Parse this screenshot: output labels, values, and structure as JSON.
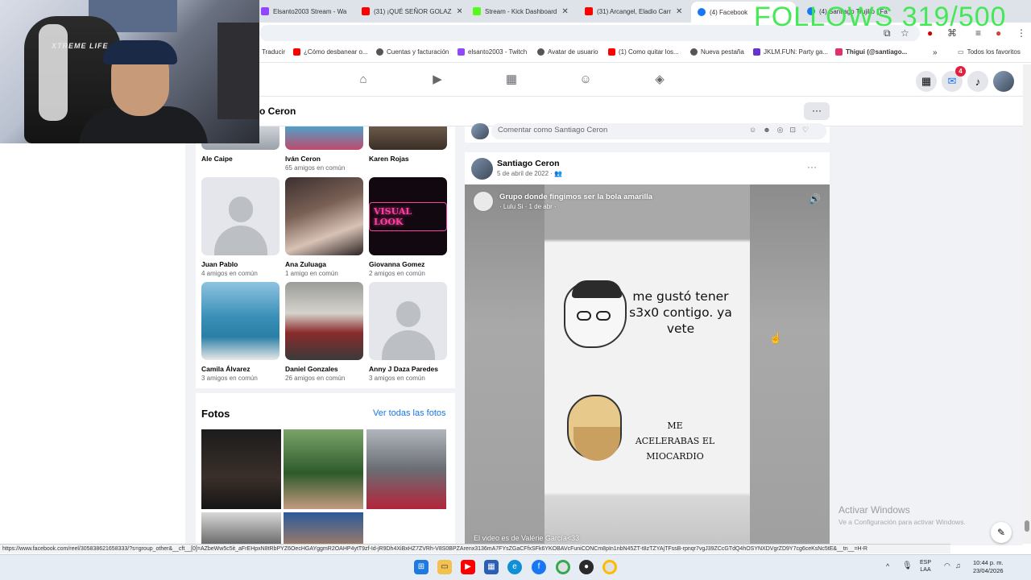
{
  "overlay": {
    "follows_text": "FOLLOWS 319/500"
  },
  "webcam": {
    "chair_logo": "XTREME LIFE"
  },
  "tabs": [
    {
      "label": "Elsanto2003 Stream - Wa",
      "favicon_color": "#9146ff"
    },
    {
      "label": "(31) ¡QUÉ SEÑOR GOLAZ",
      "favicon_color": "#ff0000"
    },
    {
      "label": "Stream - Kick Dashboard",
      "favicon_color": "#53fc18"
    },
    {
      "label": "(31) Arcangel, Eladio Carr",
      "favicon_color": "#ff0000"
    },
    {
      "label": "(4) Facebook",
      "favicon_color": "#1877f2"
    },
    {
      "label": "(4) Santiago Trujillo | Fa",
      "favicon_color": "#1877f2"
    }
  ],
  "bookmarks": [
    {
      "label": "Traducir",
      "icon_color": "#4285f4"
    },
    {
      "label": "¿Cómo desbanear o...",
      "icon_color": "#ff0000"
    },
    {
      "label": "Cuentas y facturación",
      "icon_color": "#555555"
    },
    {
      "label": "elsanto2003 - Twitch",
      "icon_color": "#9146ff"
    },
    {
      "label": "Avatar de usuario",
      "icon_color": "#555555"
    },
    {
      "label": "(1) Como quitar los...",
      "icon_color": "#ff0000"
    },
    {
      "label": "Nueva pestaña",
      "icon_color": "#555555"
    },
    {
      "label": "JKLM.FUN: Party ga...",
      "icon_color": "#6633cc"
    },
    {
      "label": "Thigui (@santiago...",
      "icon_color": "#e1306c"
    }
  ],
  "bookmarks_all": "Todos los favoritos",
  "fb_nav": {
    "notification_count": "4"
  },
  "profile_header": {
    "name_partial": "o Ceron",
    "more": "···"
  },
  "friends": [
    {
      "name": "Ale Caipe",
      "sub": ""
    },
    {
      "name": "Iván Ceron",
      "sub": "65 amigos en común"
    },
    {
      "name": "Karen Rojas",
      "sub": ""
    },
    {
      "name": "Juan Pablo",
      "sub": "4 amigos en común"
    },
    {
      "name": "Ana Zuluaga",
      "sub": "1 amigo en común"
    },
    {
      "name": "Giovanna Gomez",
      "sub": "2 amigos en común"
    },
    {
      "name": "Camila Álvarez",
      "sub": "3 amigos en común"
    },
    {
      "name": "Daniel Gonzales",
      "sub": "26 amigos en común"
    },
    {
      "name": "Anny J Daza Paredes",
      "sub": "3 amigos en común"
    }
  ],
  "neon_sign": "VISUAL LOOK",
  "photos": {
    "title": "Fotos",
    "link": "Ver todas las fotos"
  },
  "comment": {
    "placeholder": "Comentar como Santiago Ceron"
  },
  "post": {
    "author": "Santiago Ceron",
    "date": "5 de abril de 2022 · ",
    "more": "···",
    "video": {
      "group": "Grupo donde fingimos ser la bola amarilla",
      "group_sub": "· Lulu Si · 1 de abr ·",
      "meme_top": "me gustó tener s3x0 contigo. ya vete",
      "meme_bottom": "ME ACELERABAS EL MIOCARDIO",
      "caption": "El video es de Valérie García<33"
    }
  },
  "windows_activation": {
    "title": "Activar Windows",
    "sub": "Ve a Configuración para activar Windows."
  },
  "status_url": "https://www.facebook.com/reel/305838621658333/?s=group_other&__cft__[0]=AZbeWw5c5it_aFrEHpxN8tRbPYZ6OecHGAYggmR2OAHP4ytT9zf-Id-jR9Dh4XiBxHZ7ZVRh-V8S0BPZArenx3136mA7FYsZGaCFfxSFk6YKOBAVcFuniCONCm8pIn1nbN45ZT-t8zTZYAjTFssB-rpnqr7vgJ39ZCcGTdQ4hOSYNXDVgrZD9Y7cg6ceKsNc5tE&__tn__=H-R",
  "tray": {
    "lang_line1": "ESP",
    "lang_line2": "LAA",
    "time": "10:44 p. m.",
    "date": "23/04/2026"
  }
}
